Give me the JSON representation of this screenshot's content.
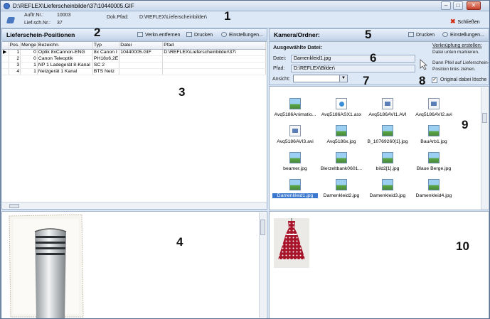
{
  "window": {
    "title": "D:\\REFLEX\\Lieferscheinbilder\\37\\10440005.GIF",
    "minimize": "–",
    "maximize": "□",
    "close": "✕"
  },
  "callouts": [
    "1",
    "2",
    "3",
    "4",
    "5",
    "6",
    "7",
    "8",
    "9",
    "10"
  ],
  "info": {
    "auftr_label": "Auftr.Nr.:",
    "auftr_value": "10003",
    "liefsch_label": "Lief.sch.Nr.:",
    "liefsch_value": "37",
    "dokpfad_label": "Dok.Pfad:",
    "dokpfad_value": "D:\\REFLEX\\Lieferscheinbilder\\",
    "close_label": "Schließen"
  },
  "left_panel": {
    "title": "Lieferschein-Positionen",
    "btn_remove": "Verkn.entfernen",
    "btn_print": "Drucken",
    "btn_settings": "Einstellungen...",
    "columns": [
      "Pos.",
      "Menge",
      "Bezeichn.",
      "Typ",
      "Datei",
      "Pfad"
    ],
    "rows": [
      {
        "marker": "▶",
        "pos": "1",
        "menge": "0",
        "bez": "Optik 8xCannon-ENG",
        "typ": "8x Canon I",
        "datei": "10440005.GIF",
        "pfad": "D:\\REFLEX\\Lieferscheinbilder\\37\\"
      },
      {
        "marker": "",
        "pos": "2",
        "menge": "0",
        "bez": "Canon Teleoptik",
        "typ": "PH18x6,2E",
        "datei": "",
        "pfad": ""
      },
      {
        "marker": "",
        "pos": "3",
        "menge": "1",
        "bez": "NP 1 Ladegerät 8-Kanal",
        "typ": "SC 2",
        "datei": "",
        "pfad": ""
      },
      {
        "marker": "",
        "pos": "4",
        "menge": "1",
        "bez": "Netzgerät 1 Kanal",
        "typ": "BTS Netz",
        "datei": "",
        "pfad": ""
      }
    ]
  },
  "right_panel": {
    "title": "Kamera/Ordner:",
    "btn_print": "Drucken",
    "btn_settings": "Einstellungen...",
    "selected_heading": "Ausgewählte Datei:",
    "datei_label": "Datei:",
    "datei_value": "Damenkleid1.jpg",
    "pfad_label": "Pfad:",
    "pfad_value": "D:\\REFLEX\\Bilder\\",
    "ansicht_label": "Ansicht:",
    "link_hint": "Verknüpfung erstellen:",
    "hint1": "Datei unten markieren.",
    "hint2": "Dann Pfeil auf Lieferschein-",
    "hint3": "Position links ziehen.",
    "original_delete": "Original dabei lösche",
    "original_checked": "✓"
  },
  "files": [
    {
      "name": "Avq5186Animatio...",
      "icon": "image-file-icon",
      "kind": "img"
    },
    {
      "name": "Avq5186ASX1.asx",
      "icon": "asx-file-icon",
      "kind": "asx"
    },
    {
      "name": "Avq5186AVI1.AVI",
      "icon": "avi-file-icon",
      "kind": "avi"
    },
    {
      "name": "Avq5186AVI2.avi",
      "icon": "avi-file-icon",
      "kind": "avi"
    },
    {
      "name": "Avq5186AVI3.avi",
      "icon": "avi-file-icon",
      "kind": "avi"
    },
    {
      "name": "Avq5186x.jpg",
      "icon": "image-file-icon",
      "kind": "img"
    },
    {
      "name": "B_10769260[1].jpg",
      "icon": "image-file-icon",
      "kind": "img"
    },
    {
      "name": "BauArb1.jpg",
      "icon": "image-file-icon",
      "kind": "img"
    },
    {
      "name": "beamer.jpg",
      "icon": "image-file-icon",
      "kind": "img"
    },
    {
      "name": "Bierzeltbank0601...",
      "icon": "image-file-icon",
      "kind": "img"
    },
    {
      "name": "bild2[1].jpg",
      "icon": "image-file-icon",
      "kind": "img"
    },
    {
      "name": "Blaue Berge.jpg",
      "icon": "image-file-icon",
      "kind": "img"
    },
    {
      "name": "Damenkleid1.jpg",
      "icon": "image-file-icon",
      "kind": "img",
      "selected": true
    },
    {
      "name": "Damenkleid2.jpg",
      "icon": "image-file-icon",
      "kind": "img"
    },
    {
      "name": "Damenkleid3.jpg",
      "icon": "image-file-icon",
      "kind": "img"
    },
    {
      "name": "Damenkleid4.jpg",
      "icon": "image-file-icon",
      "kind": "img"
    }
  ]
}
